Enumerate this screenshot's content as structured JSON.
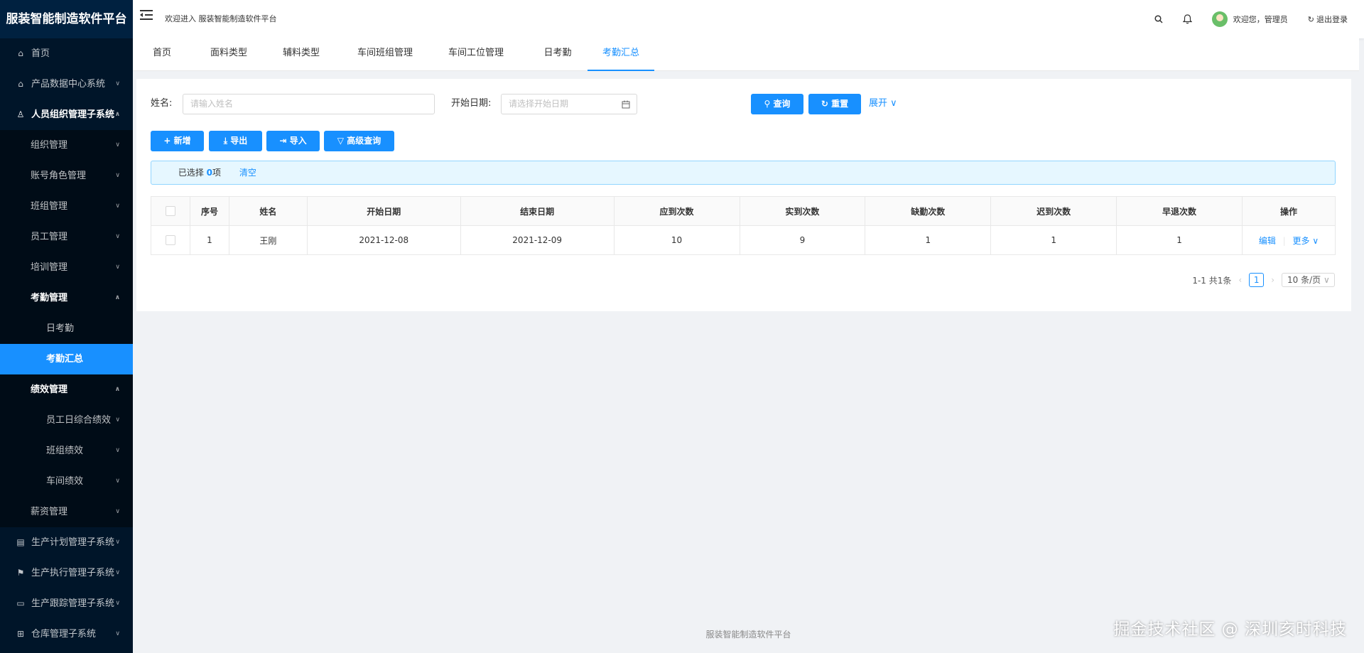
{
  "app": {
    "title": "服装智能制造软件平台"
  },
  "header": {
    "welcome": "欢迎进入 服装智能制造软件平台",
    "user_greeting": "欢迎您，管理员",
    "logout": "退出登录"
  },
  "sidebar": {
    "items": [
      {
        "label": "首页",
        "icon": "home-icon"
      },
      {
        "label": "产品数据中心系统",
        "icon": "bank-icon"
      },
      {
        "label": "人员组织管理子系统",
        "icon": "user-icon"
      },
      {
        "label": "组织管理"
      },
      {
        "label": "账号角色管理"
      },
      {
        "label": "班组管理"
      },
      {
        "label": "员工管理"
      },
      {
        "label": "培训管理"
      },
      {
        "label": "考勤管理"
      },
      {
        "label": "日考勤"
      },
      {
        "label": "考勤汇总"
      },
      {
        "label": "绩效管理"
      },
      {
        "label": "员工日综合绩效"
      },
      {
        "label": "班组绩效"
      },
      {
        "label": "车间绩效"
      },
      {
        "label": "薪资管理"
      },
      {
        "label": "生产计划管理子系统",
        "icon": "schedule-icon"
      },
      {
        "label": "生产执行管理子系统",
        "icon": "flag-icon"
      },
      {
        "label": "生产跟踪管理子系统",
        "icon": "monitor-icon"
      },
      {
        "label": "仓库管理子系统",
        "icon": "appstore-icon"
      }
    ]
  },
  "tabs": [
    "首页",
    "面料类型",
    "辅料类型",
    "车间班组管理",
    "车间工位管理",
    "日考勤",
    "考勤汇总"
  ],
  "search": {
    "name_label": "姓名:",
    "name_placeholder": "请输入姓名",
    "date_label": "开始日期:",
    "date_placeholder": "请选择开始日期",
    "query": "查询",
    "reset": "重置",
    "expand": "展开"
  },
  "toolbar": {
    "add": "新增",
    "export": "导出",
    "import": "导入",
    "advanced": "高级查询"
  },
  "selection": {
    "prefix": "已选择",
    "count": "0",
    "suffix": "项",
    "clear": "清空"
  },
  "table": {
    "columns": [
      "序号",
      "姓名",
      "开始日期",
      "结束日期",
      "应到次数",
      "实到次数",
      "缺勤次数",
      "迟到次数",
      "早退次数",
      "操作"
    ],
    "rows": [
      {
        "index": "1",
        "name": "王刚",
        "start": "2021-12-08",
        "end": "2021-12-09",
        "expected": "10",
        "actual": "9",
        "absent": "1",
        "late": "1",
        "early": "1",
        "edit": "编辑",
        "more": "更多"
      }
    ]
  },
  "pagination": {
    "total": "1-1 共1条",
    "current": "1",
    "page_size": "10 条/页"
  },
  "footer": "服装智能制造软件平台",
  "watermark": "掘金技术社区 @ 深圳亥时科技",
  "colors": {
    "primary": "#1890ff",
    "sidebar": "#001529",
    "sidebar_dark": "#000c17",
    "logo_bg": "#002140"
  }
}
